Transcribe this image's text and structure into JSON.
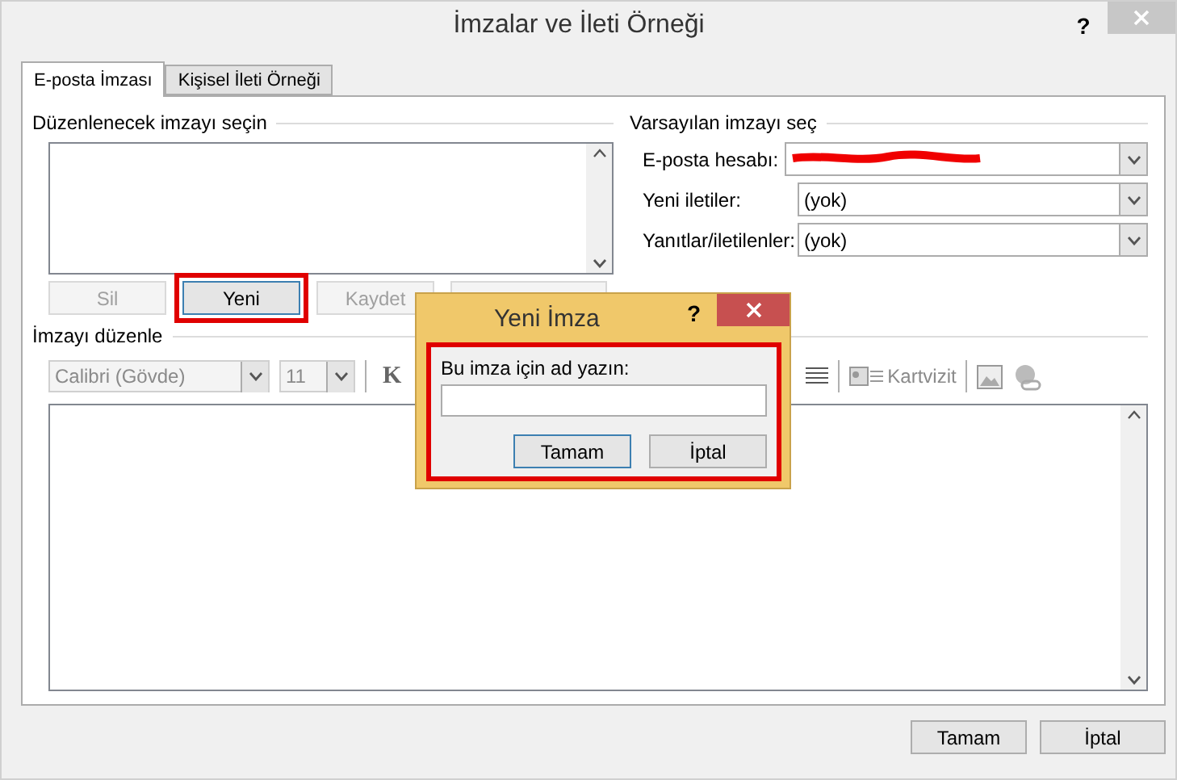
{
  "window": {
    "title": "İmzalar ve İleti Örneği",
    "help": "?"
  },
  "tabs": [
    {
      "label": "E-posta İmzası",
      "selected": true
    },
    {
      "label": "Kişisel İleti Örneği",
      "selected": false
    }
  ],
  "select_signature": {
    "heading": "Düzenlenecek imzayı seçin",
    "buttons": [
      {
        "label": "Sil",
        "disabled": true,
        "focused": false,
        "annotated": false
      },
      {
        "label": "Yeni",
        "disabled": false,
        "focused": true,
        "annotated": true
      },
      {
        "label": "Kaydet",
        "disabled": true,
        "focused": false,
        "annotated": false
      },
      {
        "disabled": true,
        "focused": false,
        "annotated": false
      }
    ]
  },
  "default_signature": {
    "heading": "Varsayılan imzayı seç",
    "rows": [
      {
        "label": "E-posta hesabı:",
        "kind": "redacted"
      },
      {
        "label": "Yeni iletiler:",
        "kind": "value",
        "value": "(yok)"
      },
      {
        "label": "Yanıtlar/iletilenler:",
        "kind": "value",
        "value": "(yok)"
      }
    ]
  },
  "edit_signature": {
    "heading": "İmzayı düzenle",
    "font": "Calibri (Gövde)",
    "size": "11",
    "bold": "K",
    "card_button": "Kartvizit"
  },
  "dialog": {
    "title": "Yeni İmza",
    "help": "?",
    "prompt": "Bu imza için ad yazın:",
    "annotated": true,
    "buttons": [
      {
        "label": "Tamam",
        "focused": true
      },
      {
        "label": "İptal",
        "focused": false
      }
    ]
  },
  "footer_buttons": [
    {
      "label": "Tamam"
    },
    {
      "label": "İptal"
    }
  ]
}
